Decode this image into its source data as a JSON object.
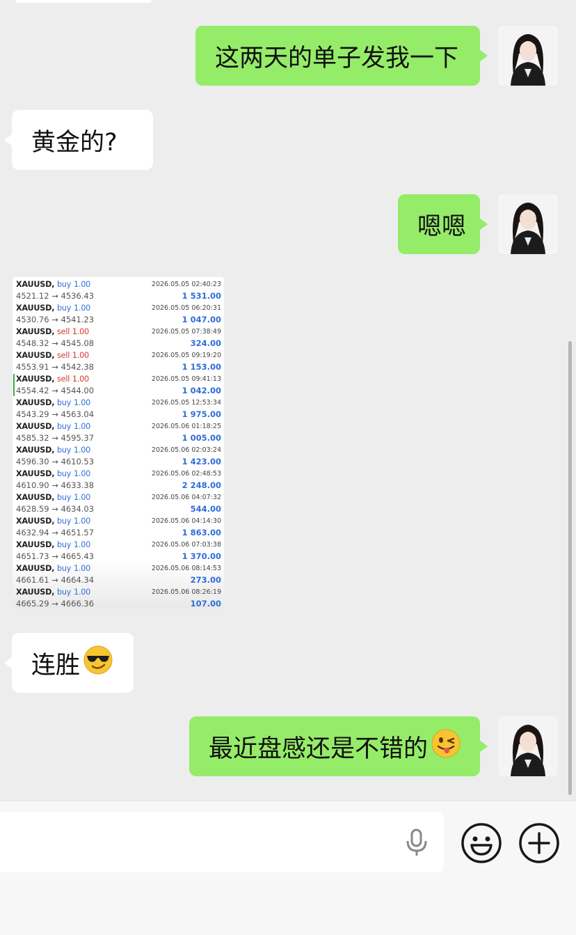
{
  "messages": [
    {
      "side": "out",
      "text": "这两天的单子发我一下"
    },
    {
      "side": "in",
      "text": "黄金的?"
    },
    {
      "side": "out",
      "text": "嗯嗯"
    },
    {
      "side": "in",
      "text": "连胜"
    },
    {
      "side": "out",
      "text": "最近盘感还是不错的"
    }
  ],
  "emojis": {
    "cool": "sunglasses-emoji",
    "wink": "winking-tongue-emoji"
  },
  "trades": [
    {
      "symbol": "XAUUSD,",
      "dir": "buy",
      "lot": "1.00",
      "time": "2026.05.05 02:40:23",
      "prices": "4521.12 → 4536.43",
      "profit": "1 531.00"
    },
    {
      "symbol": "XAUUSD,",
      "dir": "buy",
      "lot": "1.00",
      "time": "2026.05.05 06:20:31",
      "prices": "4530.76 → 4541.23",
      "profit": "1 047.00"
    },
    {
      "symbol": "XAUUSD,",
      "dir": "sell",
      "lot": "1.00",
      "time": "2026.05.05 07:38:49",
      "prices": "4548.32 → 4545.08",
      "profit": "324.00"
    },
    {
      "symbol": "XAUUSD,",
      "dir": "sell",
      "lot": "1.00",
      "time": "2026.05.05 09:19:20",
      "prices": "4553.91 → 4542.38",
      "profit": "1 153.00"
    },
    {
      "symbol": "XAUUSD,",
      "dir": "sell",
      "lot": "1.00",
      "time": "2026.05.05 09:41:13",
      "prices": "4554.42 → 4544.00",
      "profit": "1 042.00"
    },
    {
      "symbol": "XAUUSD,",
      "dir": "buy",
      "lot": "1.00",
      "time": "2026.05.05 12:53:34",
      "prices": "4543.29 → 4563.04",
      "profit": "1 975.00"
    },
    {
      "symbol": "XAUUSD,",
      "dir": "buy",
      "lot": "1.00",
      "time": "2026.05.06 01:18:25",
      "prices": "4585.32 → 4595.37",
      "profit": "1 005.00"
    },
    {
      "symbol": "XAUUSD,",
      "dir": "buy",
      "lot": "1.00",
      "time": "2026.05.06 02:03:24",
      "prices": "4596.30 → 4610.53",
      "profit": "1 423.00"
    },
    {
      "symbol": "XAUUSD,",
      "dir": "buy",
      "lot": "1.00",
      "time": "2026.05.06 02:48:53",
      "prices": "4610.90 → 4633.38",
      "profit": "2 248.00"
    },
    {
      "symbol": "XAUUSD,",
      "dir": "buy",
      "lot": "1.00",
      "time": "2026.05.06 04:07:32",
      "prices": "4628.59 → 4634.03",
      "profit": "544.00"
    },
    {
      "symbol": "XAUUSD,",
      "dir": "buy",
      "lot": "1.00",
      "time": "2026.05.06 04:14:30",
      "prices": "4632.94 → 4651.57",
      "profit": "1 863.00"
    },
    {
      "symbol": "XAUUSD,",
      "dir": "buy",
      "lot": "1.00",
      "time": "2026.05.06 07:03:38",
      "prices": "4651.73 → 4665.43",
      "profit": "1 370.00"
    },
    {
      "symbol": "XAUUSD,",
      "dir": "buy",
      "lot": "1.00",
      "time": "2026.05.06 08:14:53",
      "prices": "4661.61 → 4664.34",
      "profit": "273.00"
    },
    {
      "symbol": "XAUUSD,",
      "dir": "buy",
      "lot": "1.00",
      "time": "2026.05.06 08:26:19",
      "prices": "4665.29 → 4666.36",
      "profit": "107.00"
    }
  ],
  "input": {
    "value": ""
  },
  "icons": {
    "mic": "microphone-icon",
    "emoji": "emoji-face-icon",
    "plus": "plus-circle-icon"
  },
  "colors": {
    "outgoing_bubble": "#95ec69",
    "incoming_bubble": "#ffffff",
    "background": "#ededed",
    "buy": "#2f6dd8",
    "sell": "#d03a2f"
  }
}
